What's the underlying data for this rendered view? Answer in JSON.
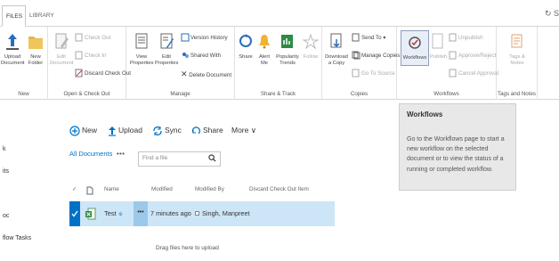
{
  "tabs": {
    "files": "FILES",
    "library": "LIBRARY"
  },
  "ribbon": {
    "new": {
      "upload": "Upload Document",
      "new_folder": "New Folder",
      "label": "New"
    },
    "open": {
      "edit": "Edit Document",
      "check_out": "Check Out",
      "check_in": "Check In",
      "discard": "Discard Check Out",
      "label": "Open & Check Out"
    },
    "manage": {
      "view_props": "View Properties",
      "edit_props": "Edit Properties",
      "version_history": "Version History",
      "shared_with": "Shared With",
      "delete": "Delete Document",
      "label": "Manage"
    },
    "share": {
      "share": "Share",
      "alert": "Alert Me",
      "popularity": "Popularity Trends",
      "follow": "Follow",
      "label": "Share & Track"
    },
    "copies": {
      "download": "Download a Copy",
      "send_to": "Send To",
      "manage_copies": "Manage Copies",
      "go_to_source": "Go To Source",
      "label": "Copies"
    },
    "workflows": {
      "workflows": "Workflows",
      "publish": "Publish",
      "unpublish": "Unpublish",
      "approve": "Approve/Reject",
      "cancel": "Cancel Approval",
      "label": "Workflows"
    },
    "tags": {
      "tags": "Tags & Notes",
      "label": "Tags and Notes"
    }
  },
  "leftnav": [
    "k",
    "its",
    "oc",
    "flow Tasks"
  ],
  "commands": {
    "new": "New",
    "upload": "Upload",
    "sync": "Sync",
    "share": "Share",
    "more": "More"
  },
  "view": {
    "all_documents": "All Documents",
    "dots": "•••",
    "find_placeholder": "Find a file"
  },
  "columns": {
    "name": "Name",
    "modified": "Modified",
    "modified_by": "Modified By",
    "discard": "Discard Check Out Item"
  },
  "rows": [
    {
      "name": "Test",
      "new_marker": "※",
      "dots": "•••",
      "modified": "7 minutes ago",
      "modified_by": "Singh, Manpreet"
    }
  ],
  "drag_hint": "Drag files here to upload",
  "tooltip": {
    "title": "Workflows",
    "body": "Go to the Workflows page to start a new workflow on the selected document or to view the status of a running or completed workflow."
  },
  "colors": {
    "accent": "#0072c6",
    "row_selected": "#cde6f7",
    "tooltip_bg": "#e8e8e8"
  }
}
